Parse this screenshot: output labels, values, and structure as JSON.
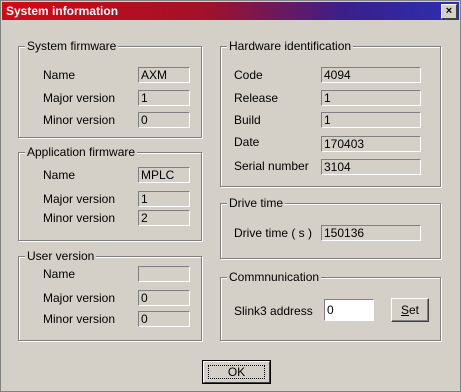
{
  "window": {
    "title": "System information",
    "close_label": "×"
  },
  "system_firmware": {
    "title": "System firmware",
    "name_label": "Name",
    "name_value": "AXM",
    "major_label": "Major version",
    "major_value": "1",
    "minor_label": "Minor version",
    "minor_value": "0"
  },
  "application_firmware": {
    "title": "Application firmware",
    "name_label": "Name",
    "name_value": "MPLC",
    "major_label": "Major version",
    "major_value": "1",
    "minor_label": "Minor version",
    "minor_value": "2"
  },
  "user_version": {
    "title": "User version",
    "name_label": "Name",
    "name_value": "",
    "major_label": "Major version",
    "major_value": "0",
    "minor_label": "Minor version",
    "minor_value": "0"
  },
  "hardware_identification": {
    "title": "Hardware identification",
    "code_label": "Code",
    "code_value": "4094",
    "release_label": "Release",
    "release_value": "1",
    "build_label": "Build",
    "build_value": "1",
    "date_label": "Date",
    "date_value": "170403",
    "serial_label": "Serial number",
    "serial_value": "3104"
  },
  "drive_time": {
    "title": "Drive time",
    "label": "Drive time ( s )",
    "value": "150136"
  },
  "communication": {
    "title": "Commnunication",
    "slink_label": "Slink3 address",
    "slink_value": "0",
    "set_label_accel": "S",
    "set_label_rest": "et"
  },
  "footer": {
    "ok_label": "OK"
  }
}
